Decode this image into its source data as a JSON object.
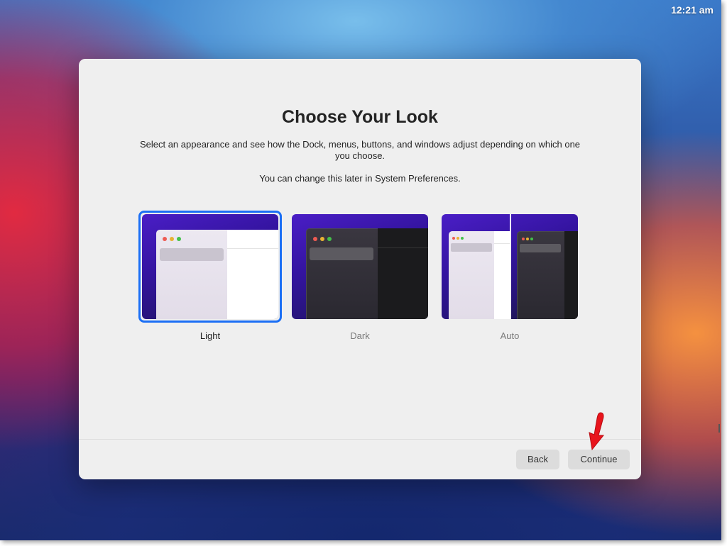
{
  "menubar": {
    "clock": "12:21 am"
  },
  "setup": {
    "title": "Choose Your Look",
    "description": "Select an appearance and see how the Dock, menus, buttons, and windows adjust depending on which one you choose.",
    "note": "You can change this later in System Preferences.",
    "options": [
      {
        "label": "Light",
        "selected": true
      },
      {
        "label": "Dark",
        "selected": false
      },
      {
        "label": "Auto",
        "selected": false
      }
    ],
    "back_label": "Back",
    "continue_label": "Continue"
  },
  "colors": {
    "selection_accent": "#1b6ff5",
    "annotation_arrow": "#e8141c"
  }
}
